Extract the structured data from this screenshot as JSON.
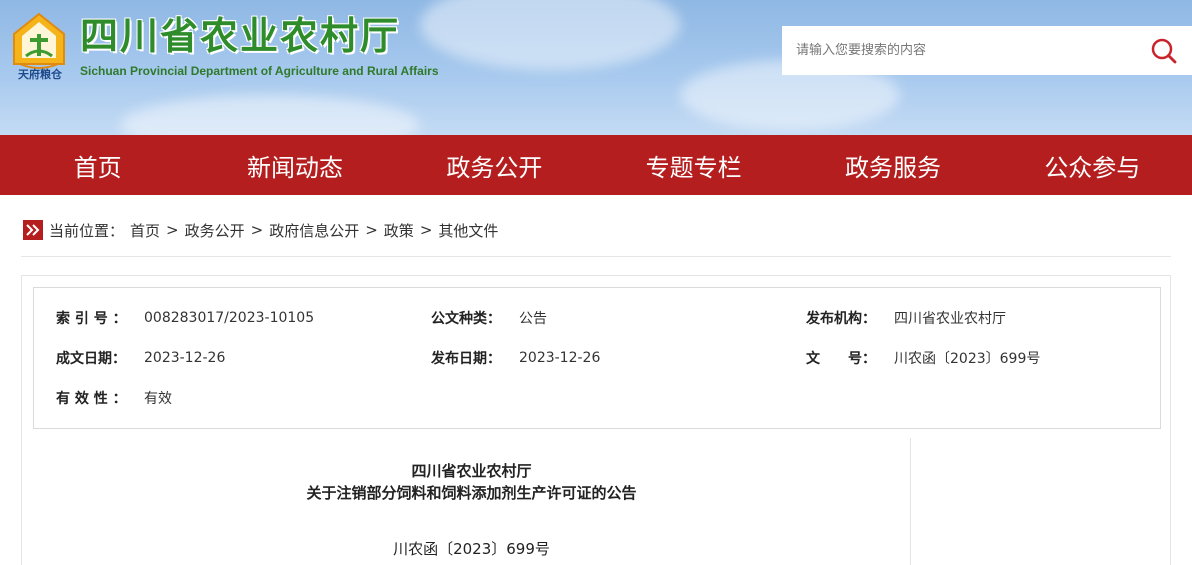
{
  "header": {
    "title": "四川省农业农村厅",
    "subtitle": "Sichuan Provincial Department of Agriculture and Rural Affairs",
    "logo_text": "天府粮仓",
    "search_placeholder": "请输入您要搜索的内容",
    "search_icon": "search-icon",
    "colors": {
      "title": "#2f8c2b",
      "nav_bg": "#b51e1e",
      "sky": "#a7c9ee"
    }
  },
  "nav": {
    "items": [
      "首页",
      "新闻动态",
      "政务公开",
      "专题专栏",
      "政务服务",
      "公众参与"
    ]
  },
  "breadcrumb": {
    "prefix": "当前位置：",
    "items": [
      "首页",
      "政务公开",
      "政府信息公开",
      "政策",
      "其他文件"
    ],
    "separator": ">"
  },
  "info": {
    "index_label": "索 引 号 ：",
    "index_value": "008283017/2023-10105",
    "category_label": "公文种类：",
    "category_value": "公告",
    "issuer_label": "发布机构：",
    "issuer_value": "四川省农业农村厅",
    "created_label": "成文日期：",
    "created_value": "2023-12-26",
    "published_label": "发布日期：",
    "published_value": "2023-12-26",
    "docno_label": "文　　号：",
    "docno_value": "川农函〔2023〕699号",
    "validity_label": "有 效 性 ：",
    "validity_value": "有效"
  },
  "article": {
    "title_line1": "四川省农业农村厅",
    "title_line2": "关于注销部分饲料和饲料添加剂生产许可证的公告",
    "doc_number": "川农函〔2023〕699号"
  }
}
